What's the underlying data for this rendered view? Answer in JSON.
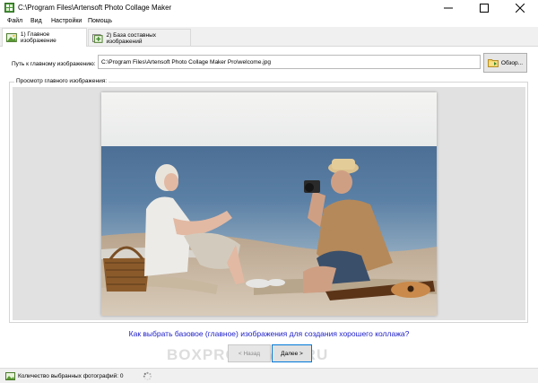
{
  "window": {
    "title": "C:\\Program Files\\Artensoft Photo Collage Maker",
    "minimize_icon": "minimize-icon",
    "maximize_icon": "maximize-icon",
    "close_icon": "close-icon"
  },
  "menu": {
    "items": [
      {
        "label": "Файл"
      },
      {
        "label": "Вид"
      },
      {
        "label": "Настройки"
      },
      {
        "label": "Помощь"
      }
    ]
  },
  "tabs": [
    {
      "label": "1) Главное изображение",
      "icon": "image-icon",
      "active": true
    },
    {
      "label": "2) База составных изображений",
      "icon": "add-images-icon",
      "active": false
    }
  ],
  "main": {
    "path_label": "Путь к главному изображению:",
    "path_value": "C:\\Program Files\\Artensoft Photo Collage Maker Pro\\welcome.jpg",
    "browse_label": "Обзор...",
    "browse_icon": "folder-icon",
    "preview_group_label": "Просмотр главного изображения:",
    "question_link": "Как выбрать базовое (главное) изображения для создания хорошего коллажа?"
  },
  "navigation": {
    "back_label": "< Назад",
    "next_label": "Далее >"
  },
  "watermark": "BOXPROGRAMS.RU",
  "status": {
    "text": "Количество выбранных фотографий: 0",
    "icon": "photos-icon",
    "spinner_icon": "loading-icon"
  },
  "colors": {
    "link": "#1c1cc8",
    "primary_border": "#0078d7",
    "preview_bg": "#e1e1e1"
  }
}
